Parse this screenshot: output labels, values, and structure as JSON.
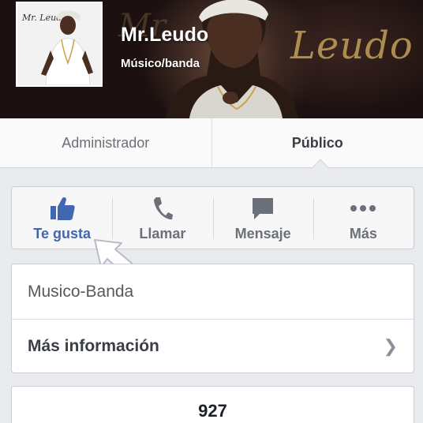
{
  "header": {
    "page_name": "Mr.Leudo",
    "category": "Músico/banda",
    "cover_script_text": "Leudo",
    "cover_script_left": "Mr.",
    "avatar_script_text": "Mr. Leudo"
  },
  "tabs": [
    {
      "label": "Administrador",
      "active": false
    },
    {
      "label": "Público",
      "active": true
    }
  ],
  "actions": [
    {
      "label": "Te gusta",
      "icon": "thumbs-up-icon",
      "color": "#4267b2",
      "active": true
    },
    {
      "label": "Llamar",
      "icon": "phone-icon",
      "active": false
    },
    {
      "label": "Mensaje",
      "icon": "message-icon",
      "active": false
    },
    {
      "label": "Más",
      "icon": "more-dots-icon",
      "active": false
    }
  ],
  "info": {
    "category_label": "Musico-Banda",
    "more_info_label": "Más información"
  },
  "stats": {
    "likes_count": "927"
  },
  "colors": {
    "accent": "#4267b2",
    "background": "#e9ebee",
    "cover_gold": "#b99a55"
  }
}
